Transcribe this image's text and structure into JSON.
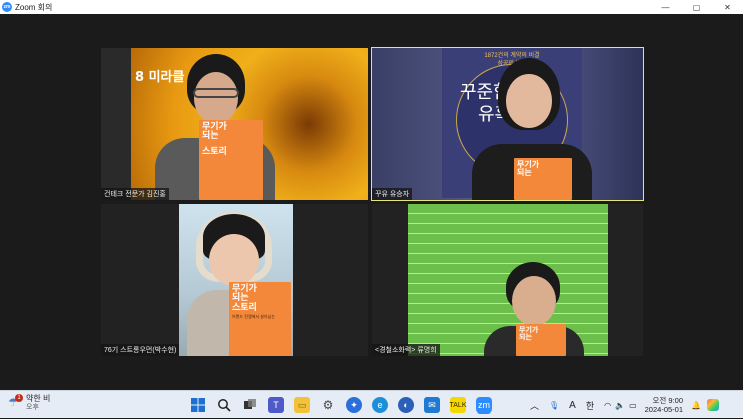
{
  "window": {
    "title": "Zoom 회의",
    "logo_text": "zm",
    "controls": {
      "minimize": "—",
      "maximize": "▢",
      "close": "✕"
    }
  },
  "tiles": [
    {
      "name": "건테크 전문가 김진홍",
      "background_text": "8 미라클",
      "book": {
        "title": "무기가 되는 스토리",
        "line1": "무기가",
        "line2": "되는",
        "line3": "스토리"
      },
      "active": false
    },
    {
      "name": "꾸유 유승자",
      "poster": {
        "line1": "1872건의 계약의 비결",
        "line2": "성공의 법칙",
        "big1": "꾸준함",
        "big2": "유혹"
      },
      "book": {
        "line1": "무기가",
        "line2": "되는"
      },
      "active": true
    },
    {
      "name": "76기 스트롱우먼(박수현)",
      "book": {
        "line1": "무기가",
        "line2": "되는",
        "line3": "스토리",
        "sub": "브랜드 전쟁에서 살아남는"
      },
      "active": false
    },
    {
      "name": "<경철소화력> 류명희",
      "book": {
        "line1": "무기가",
        "line2": "되는"
      },
      "active": false
    }
  ],
  "taskbar": {
    "weather": {
      "badge": "1",
      "label": "약한 비",
      "sub": "오후"
    },
    "search_icon": "search-icon",
    "tray": {
      "ime": "A",
      "ime2": "한",
      "time": "오전 9:00",
      "date": "2024-05-01"
    }
  }
}
